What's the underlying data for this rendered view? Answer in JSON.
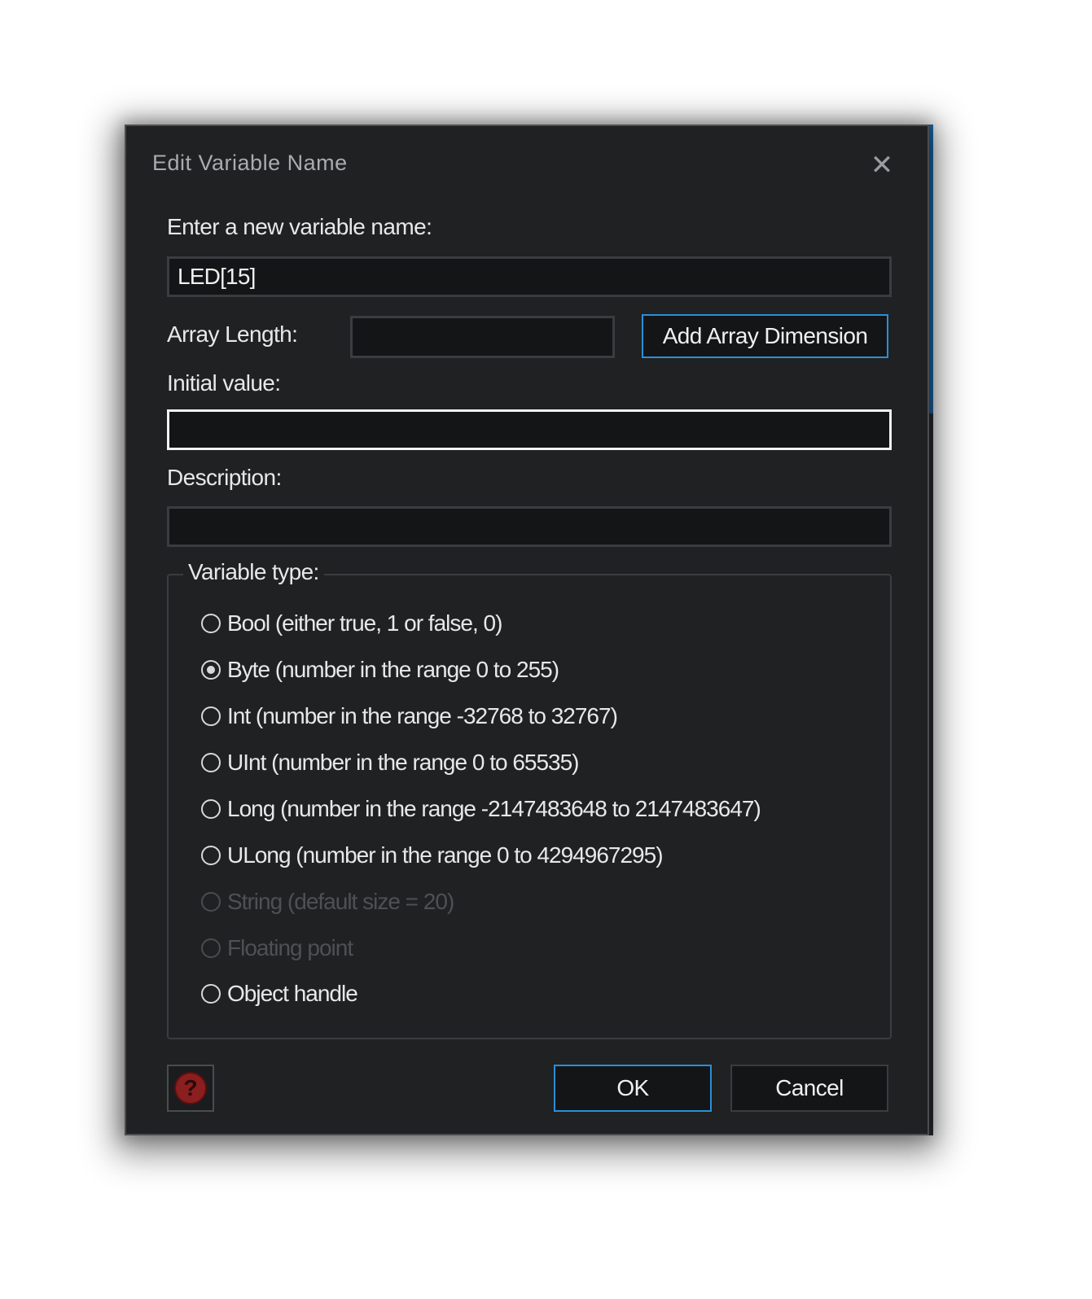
{
  "window": {
    "title": "Edit Variable Name",
    "close_glyph": "✕"
  },
  "name_field": {
    "label": "Enter a new variable name:",
    "value": "LED[15]"
  },
  "array_length": {
    "label": "Array Length:",
    "value": "",
    "button_label": "Add Array Dimension"
  },
  "initial_value": {
    "label": "Initial value:",
    "value": ""
  },
  "description": {
    "label": "Description:",
    "value": ""
  },
  "variable_type": {
    "legend": "Variable type:",
    "selected": "Byte (number in the range 0 to 255)",
    "options": [
      {
        "label": "Bool (either true, 1 or false, 0)",
        "checked": false,
        "enabled": true
      },
      {
        "label": "Byte (number in the range 0 to 255)",
        "checked": true,
        "enabled": true
      },
      {
        "label": "Int (number in the range -32768 to 32767)",
        "checked": false,
        "enabled": true
      },
      {
        "label": "UInt (number in the range 0 to 65535)",
        "checked": false,
        "enabled": true
      },
      {
        "label": "Long (number in the range -2147483648 to 2147483647)",
        "checked": false,
        "enabled": true
      },
      {
        "label": "ULong (number in the range 0 to 4294967295)",
        "checked": false,
        "enabled": true
      },
      {
        "label": "String (default size = 20)",
        "checked": false,
        "enabled": false
      },
      {
        "label": "Floating point",
        "checked": false,
        "enabled": false
      },
      {
        "label": "Object handle",
        "checked": false,
        "enabled": true
      }
    ]
  },
  "footer": {
    "help_glyph": "?",
    "ok_label": "OK",
    "cancel_label": "Cancel"
  },
  "colors": {
    "dialog_bg": "#1f2123",
    "field_bg": "#141517",
    "accent_border": "#2b8fd6",
    "help_icon": "#8b1e1e",
    "disabled_text": "#4e5053"
  },
  "icons": {
    "close": "close-icon",
    "help": "help-icon",
    "radio": "radio-icon"
  }
}
